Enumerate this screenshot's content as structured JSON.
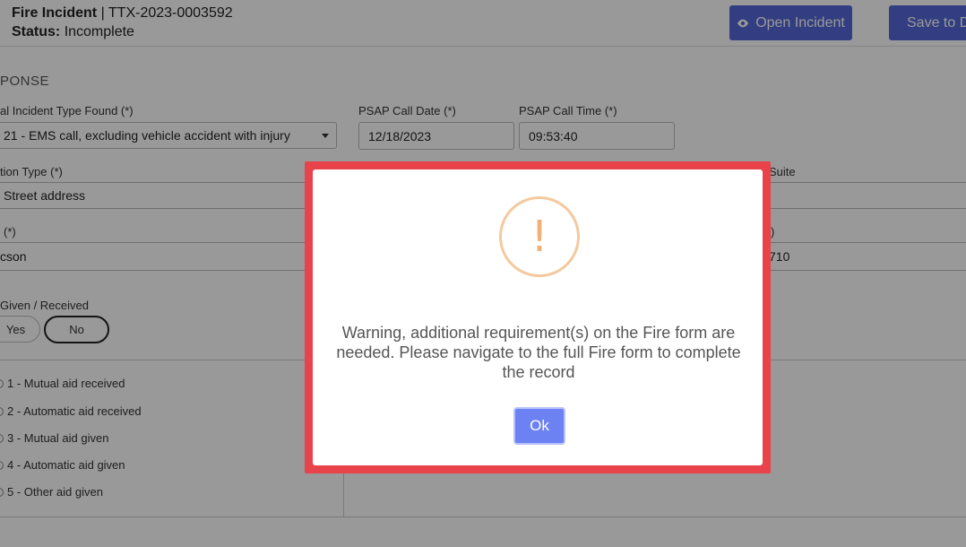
{
  "header": {
    "form_label": "Fire Incident",
    "incident_id": "| TTX-2023-0003592",
    "status_label": "Status:",
    "status_value": "Incomplete",
    "open_incident_label": "Open Incident",
    "save_label": "Save to D"
  },
  "section": {
    "title": "PONSE"
  },
  "fields": {
    "incident_type_label": "al Incident Type Found  (*)",
    "incident_type_value": "21 - EMS call, excluding vehicle accident with injury",
    "psap_date_label": "PSAP Call Date  (*)",
    "psap_date_value": "12/18/2023",
    "psap_time_label": "PSAP Call Time  (*)",
    "psap_time_value": "09:53:40",
    "location_type_label": "tion Type  (*)",
    "location_type_value": "Street address",
    "suite_label": "Suite",
    "city_label": "(*)",
    "city_value": "cson",
    "zip_label": ")",
    "zip_value": "710",
    "aid_label": "Given / Received",
    "aid_yes": "Yes",
    "aid_no": "No"
  },
  "aid_options": [
    "1 - Mutual aid received",
    "2 - Automatic aid received",
    "3 - Mutual aid given",
    "4 - Automatic aid given",
    "5 - Other aid given"
  ],
  "modal": {
    "icon": "exclamation-icon",
    "icon_glyph": "!",
    "message": "Warning, additional requirement(s) on the Fire form are needed. Please navigate to the full Fire form to complete the record",
    "ok_label": "Ok"
  },
  "colors": {
    "primary": "#5468d8",
    "modal_border": "#e8434a",
    "warning_icon": "#f2b079",
    "ok_button": "#6d82f2"
  }
}
